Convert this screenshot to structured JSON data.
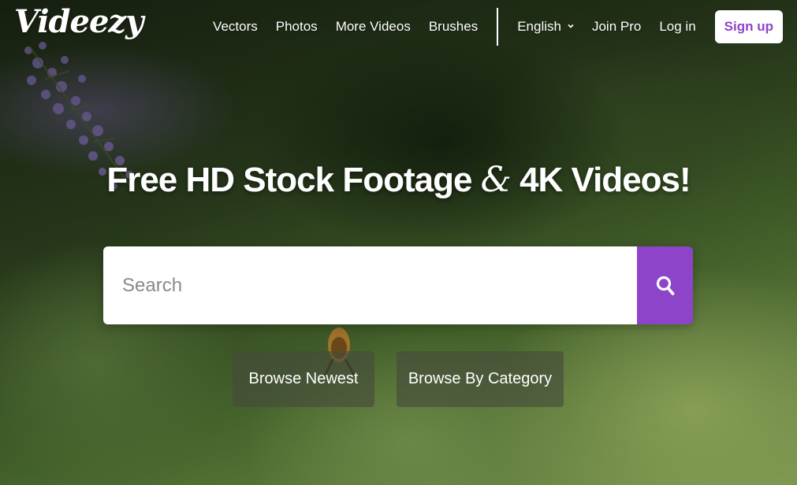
{
  "brand": {
    "logo_text": "Videezy",
    "accent_color": "#8e44c9"
  },
  "nav": {
    "links": [
      "Vectors",
      "Photos",
      "More Videos",
      "Brushes"
    ],
    "language": "English",
    "join_pro": "Join Pro",
    "login": "Log in",
    "signup": "Sign up"
  },
  "hero": {
    "title_part1": "Free HD Stock Footage",
    "title_amp": "&",
    "title_part2": "4K Videos!"
  },
  "search": {
    "placeholder": "Search",
    "value": "",
    "button_icon": "search-icon"
  },
  "browse": {
    "newest": "Browse Newest",
    "category": "Browse By Category"
  }
}
